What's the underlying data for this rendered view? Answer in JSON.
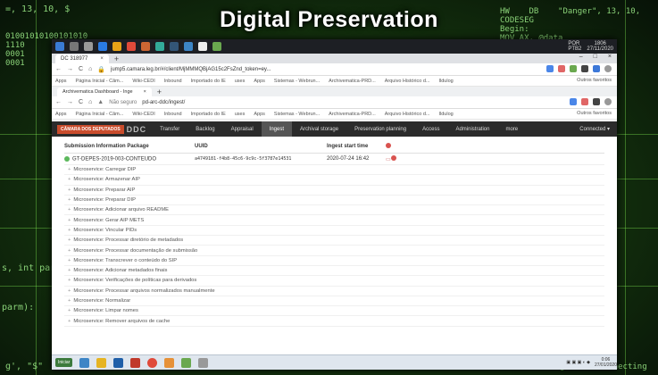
{
  "banner": {
    "title": "Digital Preservation"
  },
  "deco": {
    "top_left": "=, 13, 10, $",
    "binary": "01001010100101010\n1110\n0001\n0001",
    "top_right": "HW    DB    \"Danger\", 13, 10,\nCODESEG\nBegin:\nMOV AX, @data",
    "left_mid": "s, int parm",
    "left_low": "parm):",
    "bottom_left": "g', \"$\"",
    "bottom_right": "message, db \"Connecting"
  },
  "host_taskbar": {
    "clock_time": "1806",
    "clock_date": "27/11/2020",
    "lang": "POR\nPTB2"
  },
  "browser1": {
    "tab_title": "DC 318977",
    "url": "jump5.camara.leg.br/#/client/MjMMMQBjAG15c2FsZnd_token=ey..."
  },
  "bookmarks": [
    "Apps",
    "Página Inicial - Câm...",
    "Wiki-CEDI",
    "Inbound",
    "Importado do IE",
    "uses",
    "Apps",
    "Sistemas - Webrun...",
    "Archivematica-PRD...",
    "Arquivo Histórico d...",
    "Ildulog"
  ],
  "bookmarks_right": "Outros favoritos",
  "browser2": {
    "tab_title": "Archivematica Dashboard - Inge",
    "security": "Não seguro",
    "url": "pd-arc-ddc/ingest/"
  },
  "nav": {
    "logo": "CÂMARA DOS DEPUTADOS",
    "logo_suffix": "DDC",
    "items": [
      "Transfer",
      "Backlog",
      "Appraisal",
      "Ingest",
      "Archival storage",
      "Preservation planning",
      "Access",
      "Administration",
      "more"
    ],
    "connected": "Connected"
  },
  "table": {
    "headers": [
      "Submission Information Package",
      "UUID",
      "Ingest start time"
    ],
    "sip": {
      "name": "GT-DEPES-2019-003-CONTEUDO",
      "uuid": "a4749181-f4b8-45c6-9c9c-5f3787e14531",
      "time": "2020-07-24 16:42"
    },
    "microservices": [
      "Microservice: Carregar DIP",
      "Microservice: Armazenar AIP",
      "Microservice: Preparar AIP",
      "Microservice: Preparar DIP",
      "Microservice: Adicionar arquivo README",
      "Microservice: Gerar AIP METS",
      "Microservice: Vincular PIDs",
      "Microservice: Processar diretório de metadados",
      "Microservice: Processar documentação de submissão",
      "Microservice: Transcrever o conteúdo do SIP",
      "Microservice: Adicionar metadados finais",
      "Microservice: Verificações de políticas para derivados",
      "Microservice: Processar arquivos normalizados manualmente",
      "Microservice: Normalizar",
      "Microservice: Limpar nomes",
      "Microservice: Remover arquivos de cache"
    ]
  },
  "taskbar": {
    "start": "Iniciar",
    "clock_time": "0:06",
    "clock_date": "27/01/2020"
  },
  "colors": {
    "nav_bg": "#2b2b2b",
    "logo_red": "#c94c2c",
    "ok_green": "#5cb85c",
    "error_red": "#d9534f"
  }
}
